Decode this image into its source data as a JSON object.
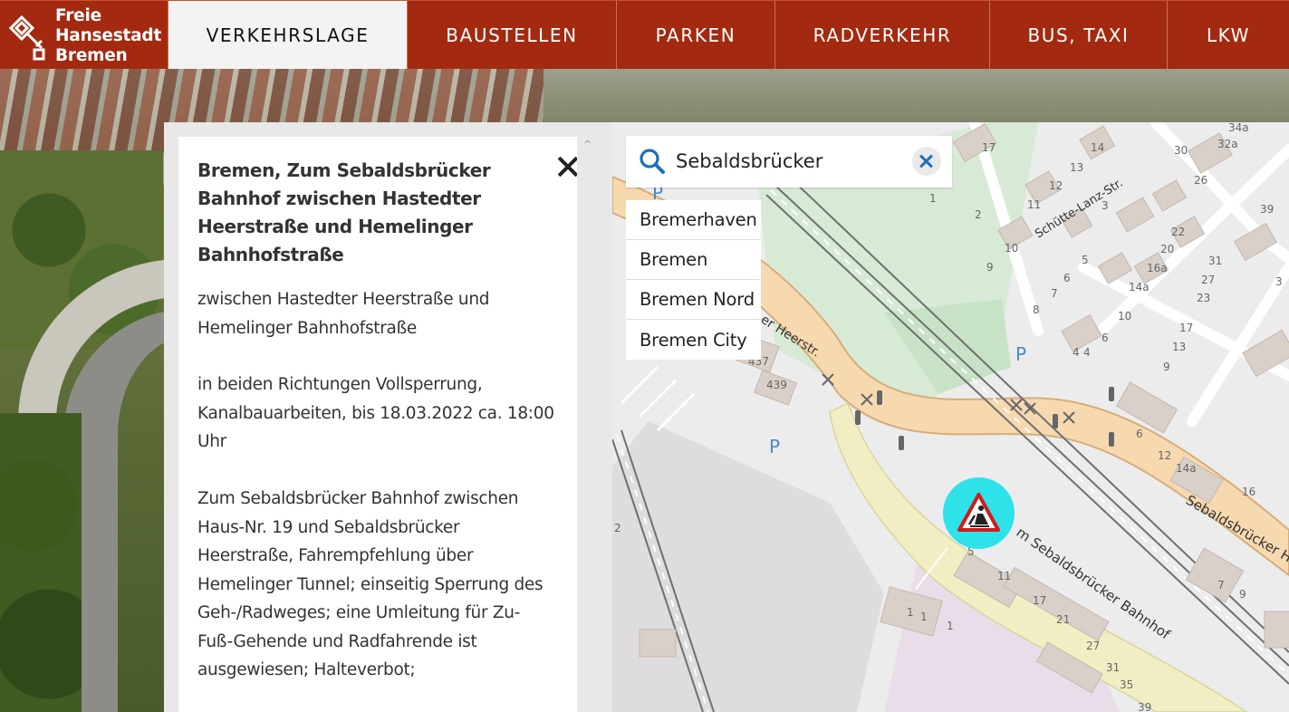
{
  "header": {
    "logo_lines": [
      "Freie",
      "Hansestadt",
      "Bremen"
    ],
    "nav": [
      {
        "label": "VERKEHRSLAGE",
        "active": true
      },
      {
        "label": "BAUSTELLEN",
        "active": false
      },
      {
        "label": "PARKEN",
        "active": false
      },
      {
        "label": "RADVERKEHR",
        "active": false
      },
      {
        "label": "BUS, TAXI",
        "active": false
      },
      {
        "label": "LKW",
        "active": false
      }
    ]
  },
  "colors": {
    "brand": "#a32a10",
    "active_tab": "#f3f3f3",
    "marker": "#2ee2ea",
    "search_icon": "#1d6fb8"
  },
  "info_panel": {
    "title": "Bremen, Zum Sebaldsbrücker Bahnhof zwischen Hastedter Heerstraße und Hemelinger Bahnhofstraße",
    "paragraphs": [
      [
        "zwischen Hastedter Heerstraße und",
        "Hemelinger Bahnhofstraße"
      ],
      [
        "in beiden Richtungen Vollsperrung,",
        "Kanalbauarbeiten, bis 18.03.2022 ca. 18:00",
        "Uhr"
      ],
      [
        "Zum Sebaldsbrücker Bahnhof zwischen",
        "Haus-Nr. 19 und Sebaldsbrücker",
        "Heerstraße, Fahrempfehlung über",
        "Hemelinger Tunnel; einseitig Sperrung des",
        "Geh-/Radweges; eine Umleitung für Zu-",
        "Fuß-Gehende und Radfahrende ist",
        "ausgewiesen; Halteverbot;"
      ]
    ],
    "scroll_up": "^"
  },
  "search": {
    "value": "Sebaldsbrücker",
    "suggestions": [
      "Bremerhaven",
      "Bremen",
      "Bremen Nord",
      "Bremen City"
    ]
  },
  "map": {
    "street_labels": [
      "Schütte-Lanz-Str.",
      "Sebaldsbrücker H",
      "m Sebaldsbrücker Bahnhof",
      "er Heerstr."
    ],
    "parking_label": "P",
    "house_numbers": [
      "17",
      "14",
      "13",
      "12",
      "11",
      "1",
      "2",
      "3",
      "10",
      "9",
      "5",
      "6",
      "7",
      "8",
      "4",
      "22",
      "20",
      "16a",
      "14a",
      "10",
      "6",
      "4",
      "437",
      "439",
      "6",
      "12",
      "14a",
      "16",
      "17",
      "13",
      "9",
      "31",
      "27",
      "23",
      "30",
      "26",
      "32a",
      "34a",
      "39",
      "3",
      "5",
      "11",
      "17",
      "21",
      "27",
      "31",
      "35",
      "39",
      "7",
      "9",
      "1",
      "1",
      "1",
      "2"
    ]
  }
}
